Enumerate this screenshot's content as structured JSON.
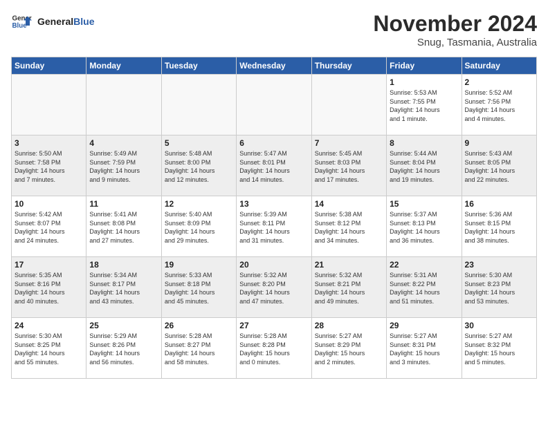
{
  "logo": {
    "text_general": "General",
    "text_blue": "Blue"
  },
  "title": "November 2024",
  "subtitle": "Snug, Tasmania, Australia",
  "weekdays": [
    "Sunday",
    "Monday",
    "Tuesday",
    "Wednesday",
    "Thursday",
    "Friday",
    "Saturday"
  ],
  "weeks": [
    [
      {
        "day": "",
        "info": ""
      },
      {
        "day": "",
        "info": ""
      },
      {
        "day": "",
        "info": ""
      },
      {
        "day": "",
        "info": ""
      },
      {
        "day": "",
        "info": ""
      },
      {
        "day": "1",
        "info": "Sunrise: 5:53 AM\nSunset: 7:55 PM\nDaylight: 14 hours\nand 1 minute."
      },
      {
        "day": "2",
        "info": "Sunrise: 5:52 AM\nSunset: 7:56 PM\nDaylight: 14 hours\nand 4 minutes."
      }
    ],
    [
      {
        "day": "3",
        "info": "Sunrise: 5:50 AM\nSunset: 7:58 PM\nDaylight: 14 hours\nand 7 minutes."
      },
      {
        "day": "4",
        "info": "Sunrise: 5:49 AM\nSunset: 7:59 PM\nDaylight: 14 hours\nand 9 minutes."
      },
      {
        "day": "5",
        "info": "Sunrise: 5:48 AM\nSunset: 8:00 PM\nDaylight: 14 hours\nand 12 minutes."
      },
      {
        "day": "6",
        "info": "Sunrise: 5:47 AM\nSunset: 8:01 PM\nDaylight: 14 hours\nand 14 minutes."
      },
      {
        "day": "7",
        "info": "Sunrise: 5:45 AM\nSunset: 8:03 PM\nDaylight: 14 hours\nand 17 minutes."
      },
      {
        "day": "8",
        "info": "Sunrise: 5:44 AM\nSunset: 8:04 PM\nDaylight: 14 hours\nand 19 minutes."
      },
      {
        "day": "9",
        "info": "Sunrise: 5:43 AM\nSunset: 8:05 PM\nDaylight: 14 hours\nand 22 minutes."
      }
    ],
    [
      {
        "day": "10",
        "info": "Sunrise: 5:42 AM\nSunset: 8:07 PM\nDaylight: 14 hours\nand 24 minutes."
      },
      {
        "day": "11",
        "info": "Sunrise: 5:41 AM\nSunset: 8:08 PM\nDaylight: 14 hours\nand 27 minutes."
      },
      {
        "day": "12",
        "info": "Sunrise: 5:40 AM\nSunset: 8:09 PM\nDaylight: 14 hours\nand 29 minutes."
      },
      {
        "day": "13",
        "info": "Sunrise: 5:39 AM\nSunset: 8:11 PM\nDaylight: 14 hours\nand 31 minutes."
      },
      {
        "day": "14",
        "info": "Sunrise: 5:38 AM\nSunset: 8:12 PM\nDaylight: 14 hours\nand 34 minutes."
      },
      {
        "day": "15",
        "info": "Sunrise: 5:37 AM\nSunset: 8:13 PM\nDaylight: 14 hours\nand 36 minutes."
      },
      {
        "day": "16",
        "info": "Sunrise: 5:36 AM\nSunset: 8:15 PM\nDaylight: 14 hours\nand 38 minutes."
      }
    ],
    [
      {
        "day": "17",
        "info": "Sunrise: 5:35 AM\nSunset: 8:16 PM\nDaylight: 14 hours\nand 40 minutes."
      },
      {
        "day": "18",
        "info": "Sunrise: 5:34 AM\nSunset: 8:17 PM\nDaylight: 14 hours\nand 43 minutes."
      },
      {
        "day": "19",
        "info": "Sunrise: 5:33 AM\nSunset: 8:18 PM\nDaylight: 14 hours\nand 45 minutes."
      },
      {
        "day": "20",
        "info": "Sunrise: 5:32 AM\nSunset: 8:20 PM\nDaylight: 14 hours\nand 47 minutes."
      },
      {
        "day": "21",
        "info": "Sunrise: 5:32 AM\nSunset: 8:21 PM\nDaylight: 14 hours\nand 49 minutes."
      },
      {
        "day": "22",
        "info": "Sunrise: 5:31 AM\nSunset: 8:22 PM\nDaylight: 14 hours\nand 51 minutes."
      },
      {
        "day": "23",
        "info": "Sunrise: 5:30 AM\nSunset: 8:23 PM\nDaylight: 14 hours\nand 53 minutes."
      }
    ],
    [
      {
        "day": "24",
        "info": "Sunrise: 5:30 AM\nSunset: 8:25 PM\nDaylight: 14 hours\nand 55 minutes."
      },
      {
        "day": "25",
        "info": "Sunrise: 5:29 AM\nSunset: 8:26 PM\nDaylight: 14 hours\nand 56 minutes."
      },
      {
        "day": "26",
        "info": "Sunrise: 5:28 AM\nSunset: 8:27 PM\nDaylight: 14 hours\nand 58 minutes."
      },
      {
        "day": "27",
        "info": "Sunrise: 5:28 AM\nSunset: 8:28 PM\nDaylight: 15 hours\nand 0 minutes."
      },
      {
        "day": "28",
        "info": "Sunrise: 5:27 AM\nSunset: 8:29 PM\nDaylight: 15 hours\nand 2 minutes."
      },
      {
        "day": "29",
        "info": "Sunrise: 5:27 AM\nSunset: 8:31 PM\nDaylight: 15 hours\nand 3 minutes."
      },
      {
        "day": "30",
        "info": "Sunrise: 5:27 AM\nSunset: 8:32 PM\nDaylight: 15 hours\nand 5 minutes."
      }
    ]
  ]
}
